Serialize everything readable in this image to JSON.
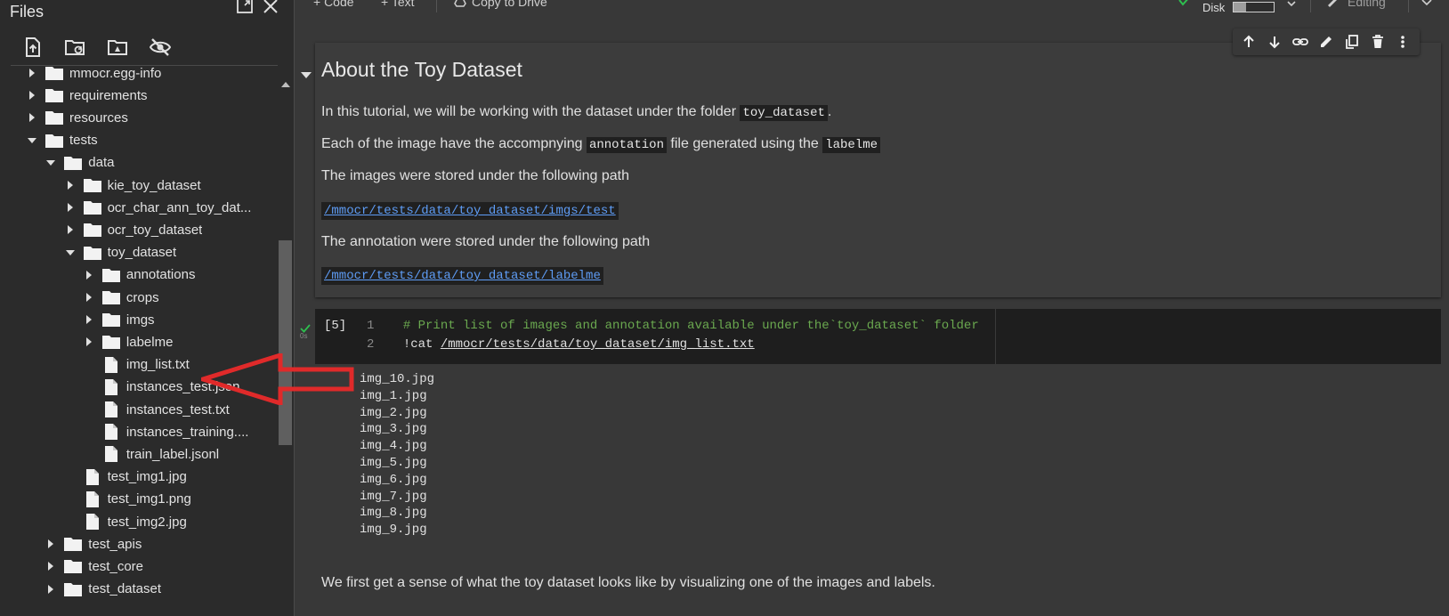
{
  "sidebar": {
    "title": "Files",
    "toolbar_icons": [
      "upload-file-icon",
      "refresh-folder-icon",
      "mount-drive-icon",
      "hide-files-icon"
    ],
    "header_icons": [
      "new-window-icon",
      "close-icon"
    ],
    "tree": [
      {
        "label": "mmocr.egg-info",
        "type": "folder",
        "depth": 0,
        "expanded": false
      },
      {
        "label": "requirements",
        "type": "folder",
        "depth": 0,
        "expanded": false
      },
      {
        "label": "resources",
        "type": "folder",
        "depth": 0,
        "expanded": false
      },
      {
        "label": "tests",
        "type": "folder",
        "depth": 0,
        "expanded": true
      },
      {
        "label": "data",
        "type": "folder",
        "depth": 1,
        "expanded": true
      },
      {
        "label": "kie_toy_dataset",
        "type": "folder",
        "depth": 2,
        "expanded": false
      },
      {
        "label": "ocr_char_ann_toy_dat...",
        "type": "folder",
        "depth": 2,
        "expanded": false
      },
      {
        "label": "ocr_toy_dataset",
        "type": "folder",
        "depth": 2,
        "expanded": false
      },
      {
        "label": "toy_dataset",
        "type": "folder",
        "depth": 2,
        "expanded": true
      },
      {
        "label": "annotations",
        "type": "folder",
        "depth": 3,
        "expanded": false
      },
      {
        "label": "crops",
        "type": "folder",
        "depth": 3,
        "expanded": false
      },
      {
        "label": "imgs",
        "type": "folder",
        "depth": 3,
        "expanded": false
      },
      {
        "label": "labelme",
        "type": "folder",
        "depth": 3,
        "expanded": false
      },
      {
        "label": "img_list.txt",
        "type": "file",
        "depth": 3
      },
      {
        "label": "instances_test.json",
        "type": "file",
        "depth": 3
      },
      {
        "label": "instances_test.txt",
        "type": "file",
        "depth": 3
      },
      {
        "label": "instances_training....",
        "type": "file",
        "depth": 3
      },
      {
        "label": "train_label.jsonl",
        "type": "file",
        "depth": 3
      },
      {
        "label": "test_img1.jpg",
        "type": "file",
        "depth": 2
      },
      {
        "label": "test_img1.png",
        "type": "file",
        "depth": 2
      },
      {
        "label": "test_img2.jpg",
        "type": "file",
        "depth": 2
      },
      {
        "label": "test_apis",
        "type": "folder",
        "depth": 1,
        "expanded": false
      },
      {
        "label": "test_core",
        "type": "folder",
        "depth": 1,
        "expanded": false
      },
      {
        "label": "test_dataset",
        "type": "folder",
        "depth": 1,
        "expanded": false
      }
    ]
  },
  "topbar": {
    "code_button": "+ Code",
    "text_button": "+ Text",
    "drive_button": "Copy to Drive",
    "disk_label": "Disk",
    "disk_usage": 0.3,
    "editing_label": "Editing"
  },
  "md_cell": {
    "heading": "About the Toy Dataset",
    "p1_pre": "In this tutorial, we will be working with the dataset under the folder ",
    "p1_code": "toy_dataset",
    "p1_post": ".",
    "p2_pre": "Each of the image have the accompnying ",
    "p2_code": "annotation",
    "p2_mid": " file generated using the ",
    "p2_code2": "labelme",
    "p3": "The images were stored under the following path",
    "p4_link": "/mmocr/tests/data/toy_dataset/imgs/test",
    "p5": "The annotation were stored under the following path",
    "p6_link": "/mmocr/tests/data/toy_dataset/labelme",
    "toolbar_icons": [
      "move-up-icon",
      "move-down-icon",
      "link-icon",
      "edit-icon",
      "mirror-cell-icon",
      "delete-icon",
      "more-icon"
    ]
  },
  "code_cell": {
    "exec_count": "[5]",
    "exec_time": "0s",
    "line1_num": "1",
    "line1": "# Print list of images and annotation available under the`toy_dataset` folder",
    "line2_num": "2",
    "line2_bang": "!cat ",
    "line2_path": "/mmocr/tests/data/toy_dataset/img_list.txt"
  },
  "output_lines": [
    "img_10.jpg",
    "img_1.jpg",
    "img_2.jpg",
    "img_3.jpg",
    "img_4.jpg",
    "img_5.jpg",
    "img_6.jpg",
    "img_7.jpg",
    "img_8.jpg",
    "img_9.jpg"
  ],
  "next_text": "We first get a sense of what the toy dataset looks like by visualizing one of the images and labels.",
  "colors": {
    "arrow": "#e02a2a",
    "link": "#5e9cf5",
    "comment": "#6aa84f",
    "success": "#2ebf4f"
  }
}
